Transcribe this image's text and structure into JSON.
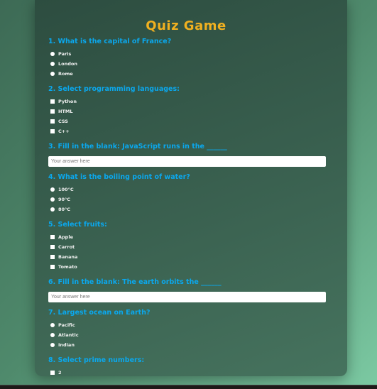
{
  "title": "Quiz Game",
  "questions": [
    {
      "text": "1. What is the capital of France?",
      "type": "radio",
      "options": [
        "Paris",
        "London",
        "Rome"
      ]
    },
    {
      "text": "2. Select programming languages:",
      "type": "checkbox",
      "options": [
        "Python",
        "HTML",
        "CSS",
        "C++"
      ]
    },
    {
      "text": "3. Fill in the blank: JavaScript runs in the ______",
      "type": "text",
      "placeholder": "Your answer here"
    },
    {
      "text": "4. What is the boiling point of water?",
      "type": "radio",
      "options": [
        "100°C",
        "90°C",
        "80°C"
      ]
    },
    {
      "text": "5. Select fruits:",
      "type": "checkbox",
      "options": [
        "Apple",
        "Carrot",
        "Banana",
        "Tomato"
      ]
    },
    {
      "text": "6. Fill in the blank: The earth orbits the ______",
      "type": "text",
      "placeholder": "Your answer here"
    },
    {
      "text": "7. Largest ocean on Earth?",
      "type": "radio",
      "options": [
        "Pacific",
        "Atlantic",
        "Indian"
      ]
    },
    {
      "text": "8. Select prime numbers:",
      "type": "checkbox",
      "options": [
        "2"
      ]
    }
  ]
}
